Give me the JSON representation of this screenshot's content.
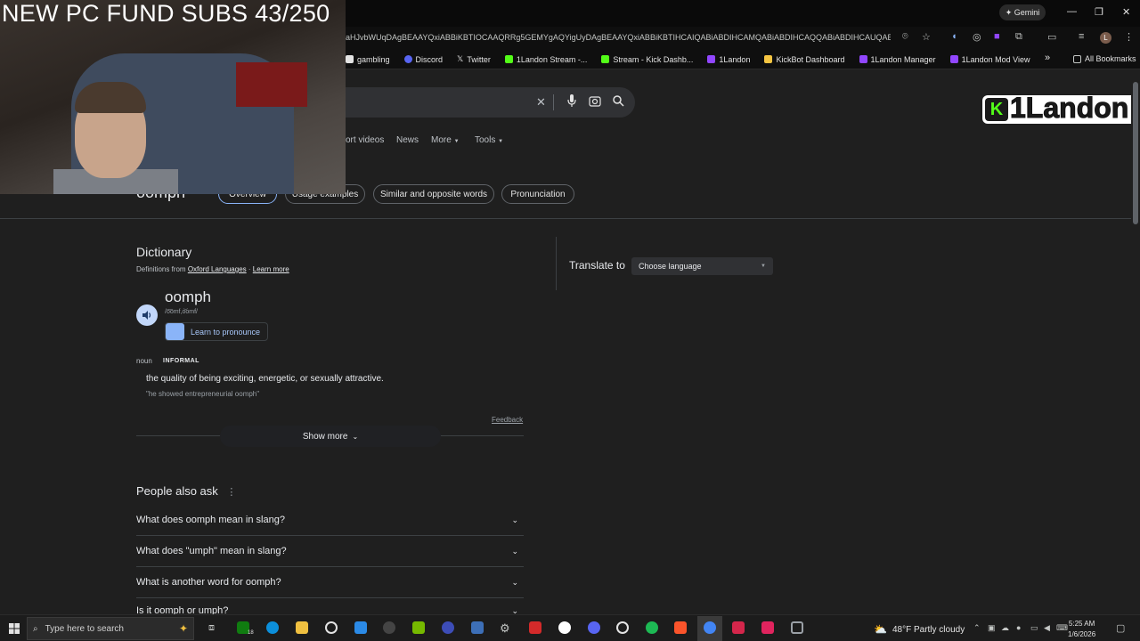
{
  "overlay": {
    "fund_text": "NEW PC FUND SUBS 43/250",
    "logo_k": "K",
    "logo_text": "1Landon"
  },
  "titlebar": {
    "gemini_label": "✦ Gemini",
    "minimize": "—",
    "restore": "❐",
    "close": "✕"
  },
  "toolbar": {
    "url_fragment": "aHJvbWUqDAgBEAAYQxiABBiKBTIOCAAQRRg5GEMYgAQYigUyDAgBEAAYQxiABBiKBTIHCAIQABiABDIHCAMQABiABDIHCAQQABiABDIHCAUQABiAB...",
    "profile_initial": "L"
  },
  "bookmarks": {
    "items": [
      {
        "label": "gambling",
        "color": "#e3e3e3"
      },
      {
        "label": "Discord",
        "color": "#5865f2"
      },
      {
        "label": "Twitter",
        "color": "#e3e3e3"
      },
      {
        "label": "1Landon Stream -...",
        "color": "#53fc18"
      },
      {
        "label": "Stream - Kick Dashb...",
        "color": "#53fc18"
      },
      {
        "label": "1Landon",
        "color": "#9146ff"
      },
      {
        "label": "KickBot Dashboard",
        "color": "#f5c542"
      },
      {
        "label": "1Landon Manager",
        "color": "#9146ff"
      },
      {
        "label": "1Landon Mod View",
        "color": "#9146ff"
      }
    ],
    "overflow": "»",
    "all_bookmarks": "All Bookmarks"
  },
  "search": {
    "clear_icon": "✕",
    "tabs": [
      "ort videos",
      "News",
      "More",
      "Tools"
    ]
  },
  "chips": [
    "Overview",
    "Usage examples",
    "Similar and opposite words",
    "Pronunciation"
  ],
  "result_heading": "oomph",
  "dictionary": {
    "title": "Dictionary",
    "source_prefix": "Definitions from",
    "source_name": "Oxford Languages",
    "learn_more": "Learn more",
    "word": "oomph",
    "phonetic": "/o͞omf,o͝omf/",
    "learn_to_pronounce": "Learn to pronounce",
    "part_of_speech": "noun",
    "register": "INFORMAL",
    "definition": "the quality of being exciting, energetic, or sexually attractive.",
    "example": "\"he showed entrepreneurial oomph\"",
    "feedback": "Feedback",
    "show_more": "Show more"
  },
  "translate": {
    "label": "Translate to",
    "select_value": "Choose language"
  },
  "paa": {
    "title": "People also ask",
    "questions": [
      "What does oomph mean in slang?",
      "What does \"umph\" mean in slang?",
      "What is another word for oomph?",
      "Is it oomph or umph?"
    ]
  },
  "taskbar": {
    "search_placeholder": "Type here to search",
    "badge": "18",
    "weather": "48°F  Partly cloudy",
    "time": "5:25 AM",
    "date": "1/6/2026"
  }
}
